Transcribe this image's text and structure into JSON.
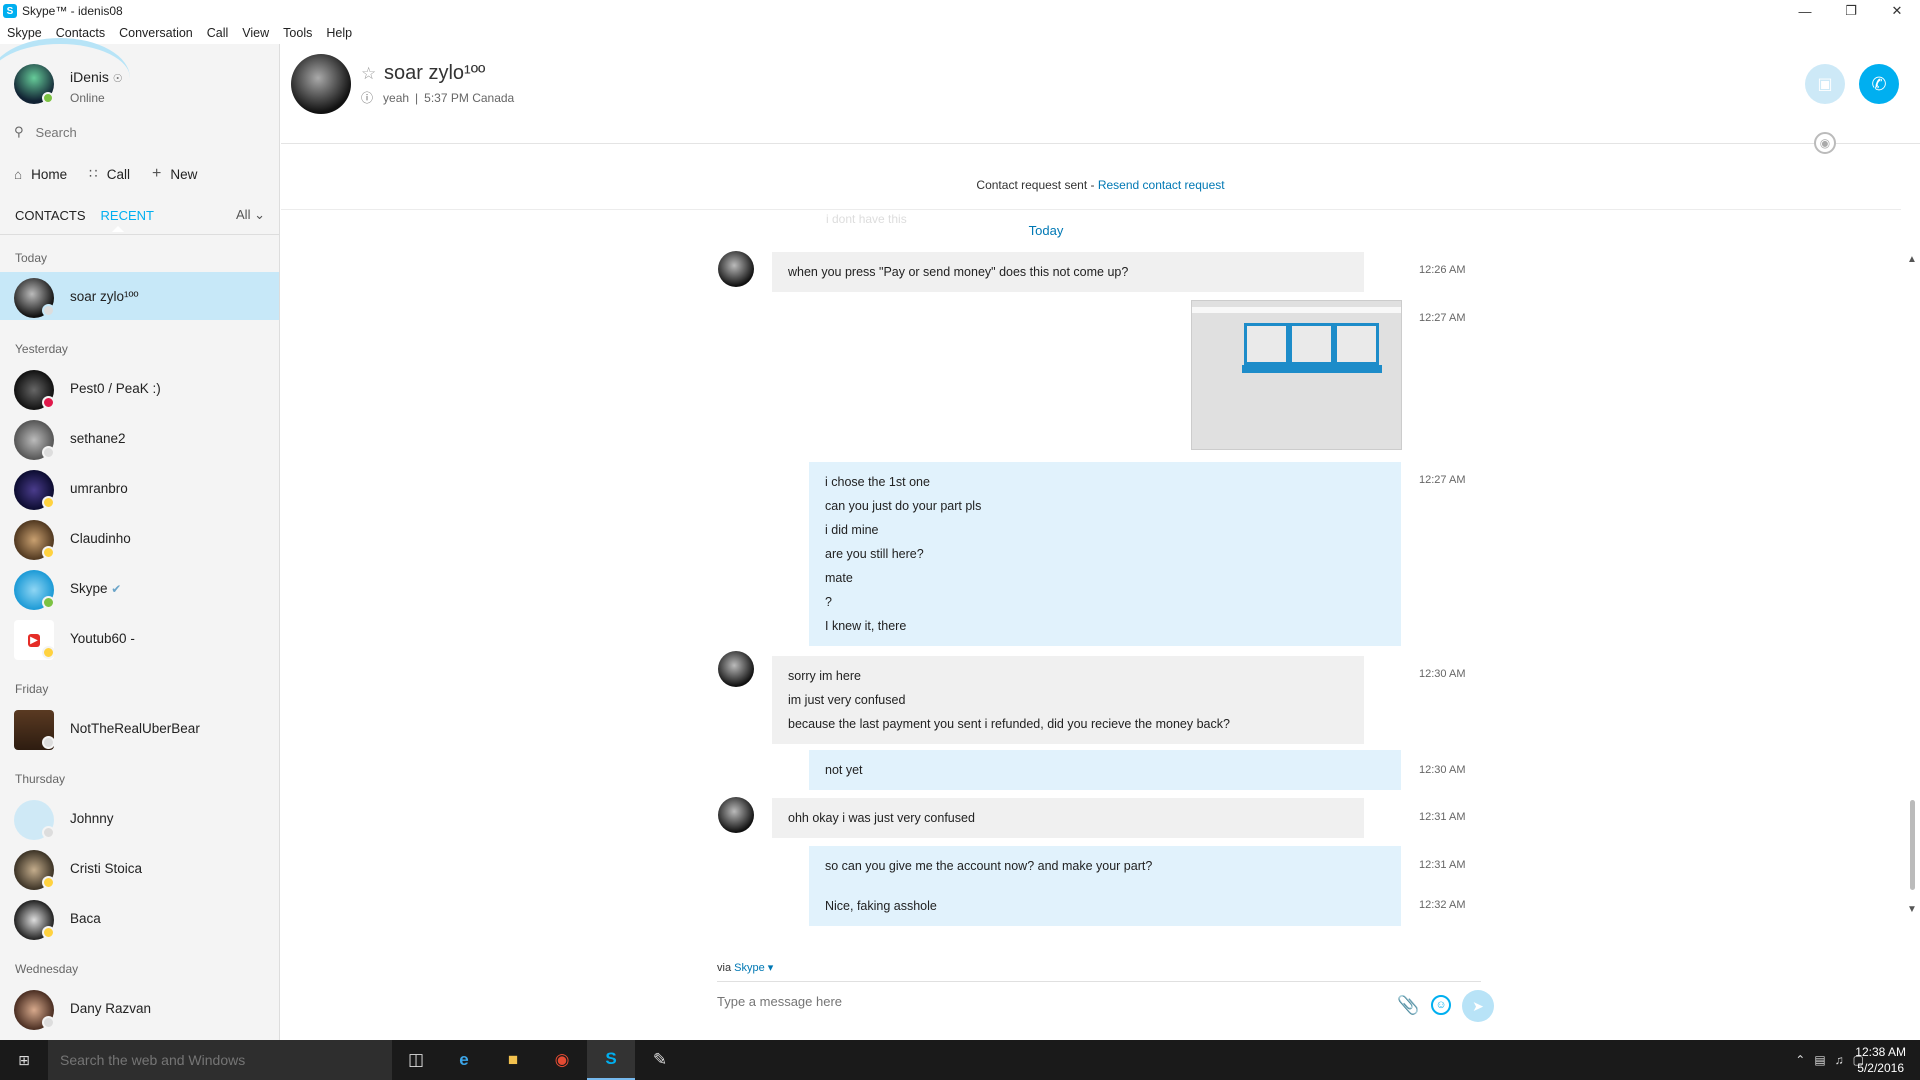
{
  "window": {
    "title": "Skype™ - idenis08"
  },
  "menu": [
    "Skype",
    "Contacts",
    "Conversation",
    "Call",
    "View",
    "Tools",
    "Help"
  ],
  "profile": {
    "name": "iDenis",
    "status": "Online"
  },
  "search": {
    "placeholder": "Search"
  },
  "nav": {
    "home": "Home",
    "call": "Call",
    "new": "New"
  },
  "tabs": {
    "contacts": "CONTACTS",
    "recent": "RECENT",
    "filter": "All"
  },
  "sections": {
    "today": "Today",
    "yesterday": "Yesterday",
    "friday": "Friday",
    "thursday": "Thursday",
    "wednesday": "Wednesday"
  },
  "contacts": [
    {
      "name": "soar zylo¹ºº"
    },
    {
      "name": "Pest0 / PeaK :)"
    },
    {
      "name": "sethane2"
    },
    {
      "name": "umranbro"
    },
    {
      "name": "Claudinho"
    },
    {
      "name": "Skype"
    },
    {
      "name": "Youtub60 -"
    },
    {
      "name": "NotTheRealUberBear"
    },
    {
      "name": "Johnny"
    },
    {
      "name": "Cristi Stoica"
    },
    {
      "name": "Baca"
    },
    {
      "name": "Dany Razvan"
    }
  ],
  "conversation": {
    "name": "soar zylo¹ºº",
    "mood": "yeah",
    "local_time": "5:37 PM Canada",
    "notice_text": "Contact request sent - ",
    "notice_link": "Resend contact request",
    "date_label": "Today",
    "ghost_text": "i dont have this"
  },
  "messages": {
    "m1": {
      "lines": [
        "when you press \"Pay or send money\" does this not come up?"
      ],
      "time": "12:26 AM"
    },
    "m2": {
      "time": "12:27 AM"
    },
    "m3": {
      "lines": [
        "i chose the 1st one",
        "can you just do your part pls",
        "i did mine",
        "are you still here?",
        "mate",
        "?",
        "I knew it, there"
      ],
      "time": "12:27 AM"
    },
    "m4": {
      "lines": [
        "sorry im here",
        "im just very confused",
        "because the last payment you sent i refunded, did you recieve the money back?"
      ],
      "time": "12:30 AM"
    },
    "m5": {
      "lines": [
        "not yet"
      ],
      "time": "12:30 AM"
    },
    "m6": {
      "lines": [
        "ohh okay i was just very confused"
      ],
      "time": "12:31 AM"
    },
    "m7": {
      "lines": [
        "so can you give me the account now? and make your part?"
      ],
      "time": "12:31 AM"
    },
    "m8": {
      "lines": [
        "Nice, faking asshole"
      ],
      "time": "12:32 AM"
    }
  },
  "compose": {
    "via_label": "via",
    "via_service": "Skype",
    "placeholder": "Type a message here"
  },
  "taskbar": {
    "search_placeholder": "Search the web and Windows",
    "time": "12:38 AM",
    "date": "5/2/2016"
  },
  "colors": {
    "accent": "#00aff0",
    "selected": "#c7e8f8",
    "outgoing": "#e1f2fc",
    "incoming": "#f0f0f0",
    "online": "#7cc242",
    "away": "#ffd23f",
    "busy": "#e0194b"
  }
}
